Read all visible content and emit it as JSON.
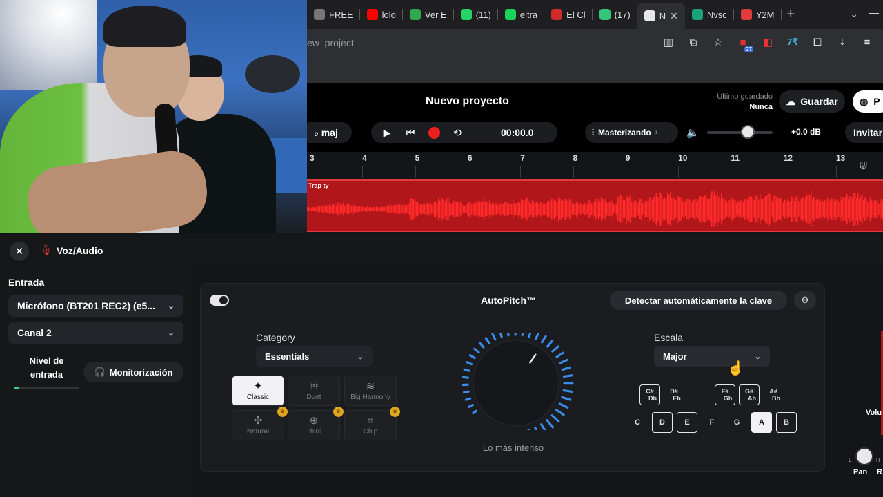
{
  "browser": {
    "tabs": [
      {
        "label": "FREE",
        "color": "#777777",
        "active": false
      },
      {
        "label": "lolo",
        "color": "#ff0000",
        "active": false
      },
      {
        "label": "Ver E",
        "color": "#2fa84f",
        "active": false
      },
      {
        "label": "(11)",
        "color": "#25d366",
        "active": false
      },
      {
        "label": "eltra",
        "color": "#1ad35a",
        "active": false
      },
      {
        "label": "El Cl",
        "color": "#d02b2b",
        "active": false
      },
      {
        "label": "(17)",
        "color": "#34c77b",
        "active": false
      },
      {
        "label": "N",
        "color": "#e8e8ea",
        "active": true
      },
      {
        "label": "Nvsc",
        "color": "#1aa37a",
        "active": false
      },
      {
        "label": "Y2M",
        "color": "#e23b3b",
        "active": false
      }
    ],
    "url": "ew_project",
    "extension_badge": "27"
  },
  "app": {
    "project_title": "Nuevo proyecto",
    "last_saved_label": "Último guardado",
    "last_saved_value": "Nunca",
    "save_label": "Guardar",
    "publish_label": "P",
    "key_label": "maj",
    "time": "00:00.0",
    "mastering_label": "Masterizando",
    "db_value": "+0.0 dB",
    "volume_level": 0.62,
    "invite_label": "Invitar"
  },
  "timeline": {
    "ticks": [
      "3",
      "4",
      "5",
      "6",
      "7",
      "8",
      "9",
      "10",
      "11",
      "12",
      "13"
    ],
    "track_name": "Trap ty",
    "track_color": "#b1161b"
  },
  "panel": {
    "title": "Voz/Audio",
    "input_label": "Entrada",
    "mic_device": "Micrófono (BT201 REC2) (e5...",
    "channel": "Canal 2",
    "level_label": "Nivel de entrada",
    "monitor_label": "Monitorización",
    "input_level": 0.08
  },
  "autopitch": {
    "title": "AutoPitch™",
    "detect_label": "Detectar automáticamente la clave",
    "category_label": "Category",
    "category_value": "Essentials",
    "presets": [
      {
        "label": "Classic",
        "icon": "sparkle-icon",
        "glyph": "✦",
        "active": true,
        "premium": false
      },
      {
        "label": "Duet",
        "icon": "duet-icon",
        "glyph": "♾",
        "active": false,
        "premium": false
      },
      {
        "label": "Big Harmony",
        "icon": "harmony-icon",
        "glyph": "≋",
        "active": false,
        "premium": false
      },
      {
        "label": "Natural",
        "icon": "natural-icon",
        "glyph": "✣",
        "active": false,
        "premium": true
      },
      {
        "label": "Third",
        "icon": "third-icon",
        "glyph": "⊕",
        "active": false,
        "premium": true
      },
      {
        "label": "Chip",
        "icon": "chip-icon",
        "glyph": "⌗",
        "active": false,
        "premium": true
      }
    ],
    "intensity_label": "Lo más intenso",
    "intensity": 0.55,
    "scale_label": "Escala",
    "scale_value": "Major",
    "sharp_keys": [
      {
        "top": "C#",
        "bottom": "Db",
        "outlined": true
      },
      {
        "top": "D#",
        "bottom": "Eb",
        "outlined": false
      },
      {
        "top": "F#",
        "bottom": "Gb",
        "outlined": true
      },
      {
        "top": "G#",
        "bottom": "Ab",
        "outlined": true
      },
      {
        "top": "A#",
        "bottom": "Bb",
        "outlined": false
      }
    ],
    "natural_keys": [
      {
        "label": "C",
        "state": "plain"
      },
      {
        "label": "D",
        "state": "outlined"
      },
      {
        "label": "E",
        "state": "outlined"
      },
      {
        "label": "F",
        "state": "plain"
      },
      {
        "label": "G",
        "state": "plain"
      },
      {
        "label": "A",
        "state": "filled"
      },
      {
        "label": "B",
        "state": "outlined"
      }
    ]
  },
  "mixer": {
    "volume_label": "Volu",
    "pan_label": "Pan",
    "left_label": "L",
    "right_label": "R",
    "right_edge_label": "R"
  }
}
